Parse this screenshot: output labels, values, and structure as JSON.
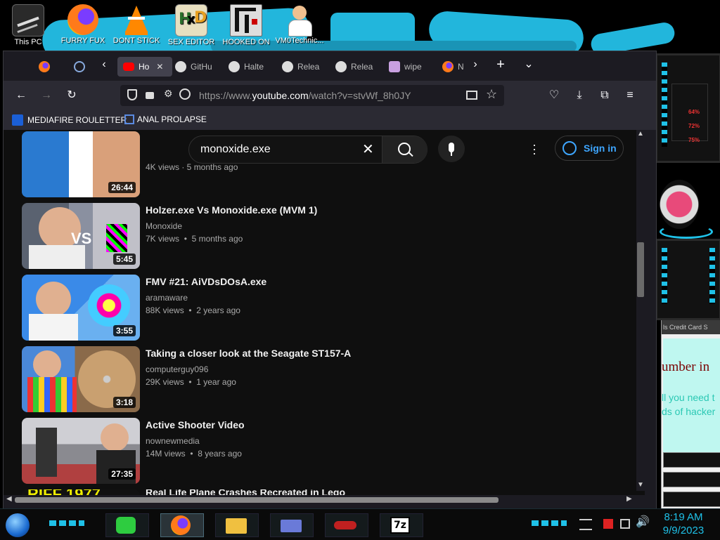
{
  "desktop": {
    "icons": [
      {
        "label": "This PC",
        "icon": "this-pc-icon"
      },
      {
        "label": "FURRY FUX",
        "icon": "firefox-icon"
      },
      {
        "label": "DONT STICK",
        "icon": "vlc-icon"
      },
      {
        "label": "SEX EDITOR",
        "icon": "hxd-icon"
      },
      {
        "label": "HOOKED ON",
        "icon": "maze-icon"
      },
      {
        "label": "VM0Technic...",
        "icon": "doctor-icon"
      }
    ],
    "gadget_percents": [
      "64%",
      "72%",
      "75%"
    ],
    "side_window": {
      "tab_text": "ls Credit Card S",
      "heading": "umber in",
      "line1": "ll you need t",
      "line2": "ds of hacker"
    }
  },
  "browser": {
    "tabs": [
      {
        "label": "",
        "icon": "firefox-icon"
      },
      {
        "label": "",
        "icon": "globe-icon"
      },
      {
        "label": "Ho",
        "icon": "youtube-icon",
        "active": true
      },
      {
        "label": "GitHu",
        "icon": "github-icon"
      },
      {
        "label": "Halte",
        "icon": "github-icon"
      },
      {
        "label": "Relea",
        "icon": "github-icon"
      },
      {
        "label": "Relea",
        "icon": "github-icon"
      },
      {
        "label": "wipe",
        "icon": "wipe-icon"
      },
      {
        "label": "N",
        "icon": "firefox-icon"
      }
    ],
    "url_prefix": "https://www.",
    "url_host": "youtube.com",
    "url_path": "/watch?v=stvWf_8h0JY",
    "bookmarks": [
      {
        "label": "MEDIAFIRE ROULETTER",
        "icon": "mediafire-icon"
      },
      {
        "label": "ANAL PROLAPSE",
        "icon": "bookmark-icon"
      }
    ]
  },
  "youtube": {
    "search_value": "monoxide.exe",
    "sign_in": "Sign in",
    "partial_top": {
      "duration": "26:44",
      "meta": "4K views · 5 months ago"
    },
    "videos": [
      {
        "title": "Holzer.exe Vs Monoxide.exe (MVM 1)",
        "channel": "Monoxide",
        "views": "7K views",
        "age": "5 months ago",
        "duration": "5:45"
      },
      {
        "title": "FMV #21: AiVDsDOsA.exe",
        "channel": "aramaware",
        "views": "88K views",
        "age": "2 years ago",
        "duration": "3:55"
      },
      {
        "title": "Taking a closer look at the Seagate ST157-A",
        "channel": "computerguy096",
        "views": "29K views",
        "age": "1 year ago",
        "duration": "3:18"
      },
      {
        "title": "Active Shooter Video",
        "channel": "nownewmedia",
        "views": "14M views",
        "age": "8 years ago",
        "duration": "27:35"
      }
    ],
    "partial_bottom": {
      "title": "Real Life Plane Crashes Recreated in Lego",
      "thumb_text": "RIFF 1977"
    }
  },
  "taskbar": {
    "time": "8:19 AM",
    "date": "9/9/2023",
    "apps": [
      "notes-icon",
      "firefox-icon",
      "file-explorer-icon",
      "id-card-icon",
      "rocket-icon",
      "7zip-icon"
    ]
  }
}
